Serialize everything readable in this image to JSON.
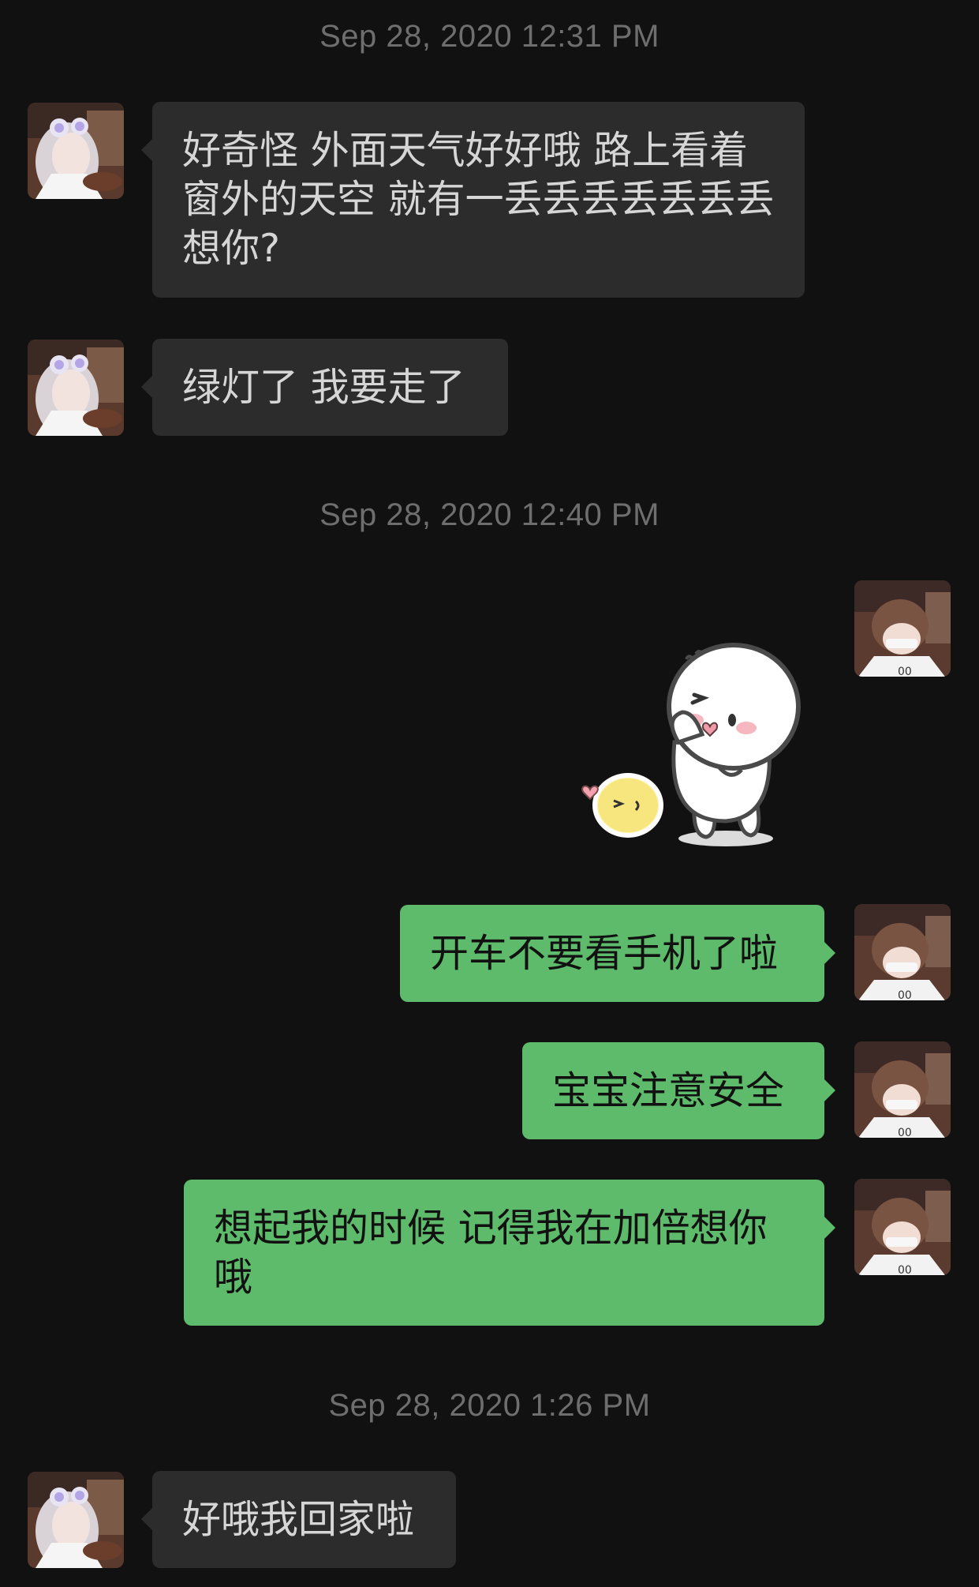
{
  "chat": {
    "timestamps": [
      "Sep 28, 2020 12:31 PM",
      "Sep 28, 2020 12:40 PM",
      "Sep 28, 2020 1:26 PM"
    ],
    "messages": [
      {
        "sender": "contact",
        "type": "text",
        "text": "好奇怪 外面天气好好哦 路上看着窗外的天空 就有一丢丢丢丢丢丢丢想你?"
      },
      {
        "sender": "contact",
        "type": "text",
        "text": "绿灯了 我要走了"
      },
      {
        "sender": "me",
        "type": "sticker",
        "sticker": "white-blob-blowing-kiss-with-yellow-chick"
      },
      {
        "sender": "me",
        "type": "text",
        "text": "开车不要看手机了啦"
      },
      {
        "sender": "me",
        "type": "text",
        "text": "宝宝注意安全"
      },
      {
        "sender": "me",
        "type": "text",
        "text": "想起我的时候 记得我在加倍想你哦"
      },
      {
        "sender": "contact",
        "type": "text",
        "text": "好哦我回家啦"
      }
    ]
  },
  "colors": {
    "background": "#111111",
    "incoming_bubble": "#2c2c2c",
    "outgoing_bubble": "#5dbb6b",
    "timestamp_text": "#6e6e6e"
  }
}
